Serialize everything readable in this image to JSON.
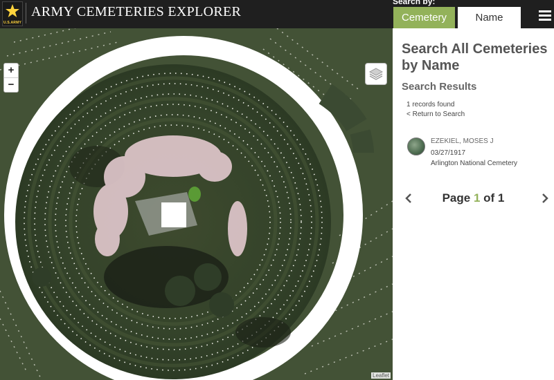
{
  "header": {
    "logo_text": "U.S.ARMY",
    "title": "ARMY CEMETERIES EXPLORER",
    "search_by_label": "Search by:",
    "tabs": [
      {
        "label": "Cemetery",
        "active": false
      },
      {
        "label": "Name",
        "active": true
      }
    ],
    "menu_icon": "hamburger-menu-icon"
  },
  "map": {
    "zoom_in": "+",
    "zoom_out": "−",
    "layers_icon": "layers-icon",
    "attribution": "Leaflet"
  },
  "panel": {
    "title": "Search All Cemeteries by Name",
    "subtitle": "Search Results",
    "records_found": "1 records found",
    "return_link": "< Return to Search",
    "results": [
      {
        "name": "EZEKIEL, MOSES J",
        "date": "03/27/1917",
        "cemetery": "Arlington National Cemetery"
      }
    ],
    "pagination": {
      "prefix": "Page ",
      "current": "1",
      "separator": " of ",
      "total": "1"
    }
  },
  "colors": {
    "header_bg": "#1f1f1f",
    "accent_green": "#93b25a",
    "logo_gold": "#ffd33d"
  }
}
